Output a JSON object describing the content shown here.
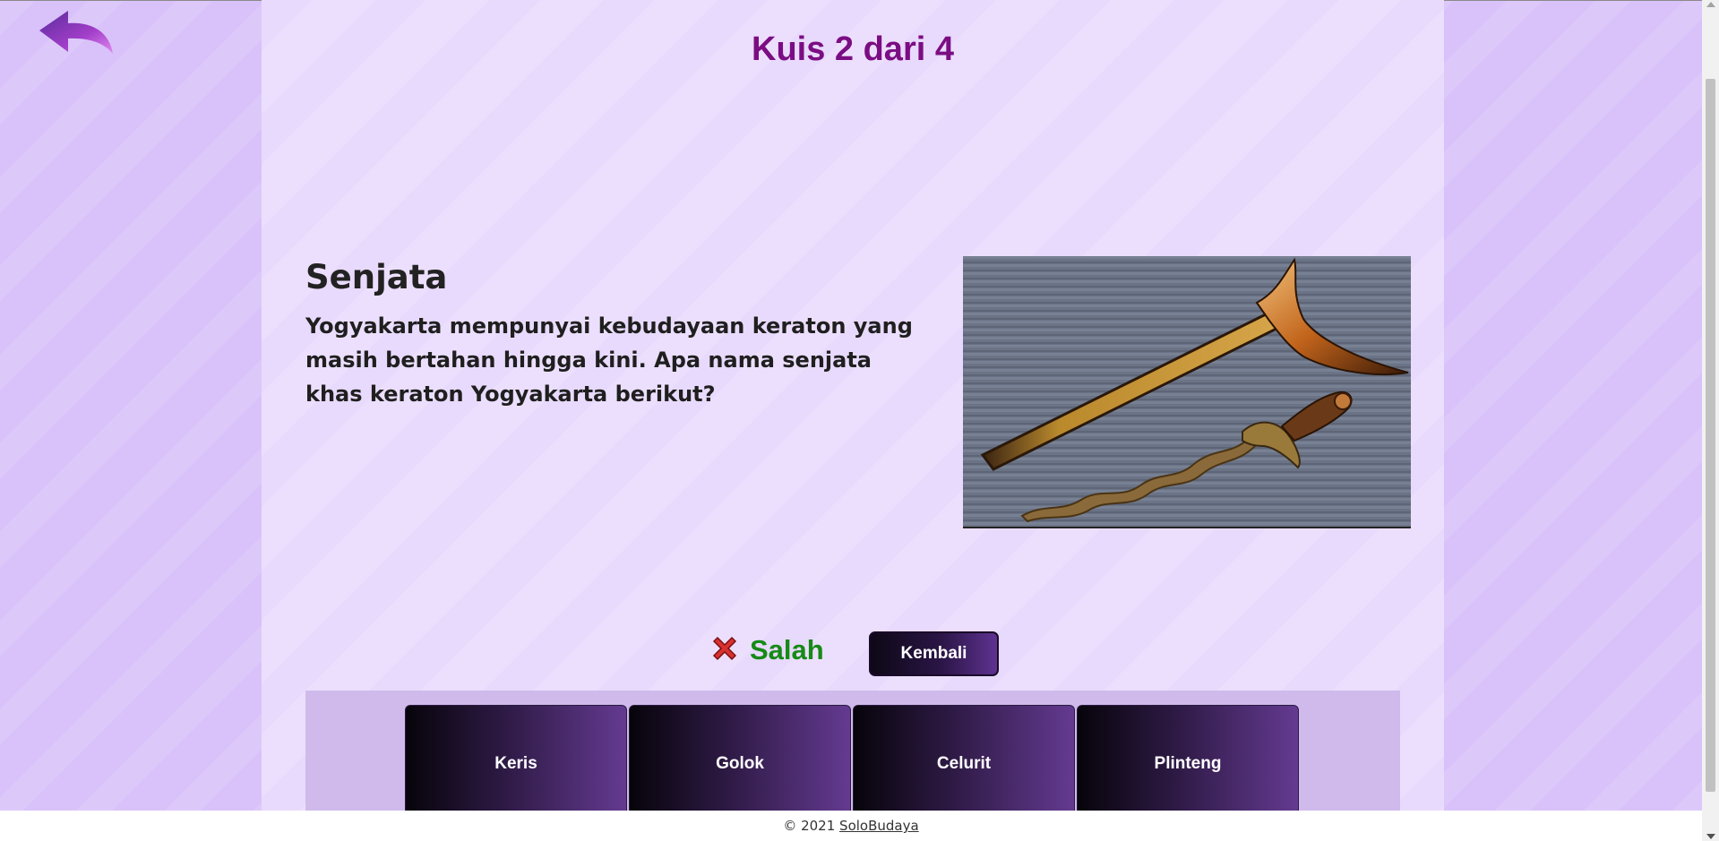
{
  "quiz": {
    "title": "Kuis 2 dari 4",
    "category": "Senjata",
    "question": "Yogyakarta mempunyai kebudayaan keraton yang masih bertahan hingga kini. Apa nama senjata khas keraton Yogyakarta berikut?",
    "image_subject": "keris with wooden sheath"
  },
  "result": {
    "icon": "cross-icon",
    "text": "Salah",
    "text_color": "#168a16",
    "icon_color": "#d93030"
  },
  "kembali_label": "Kembali",
  "answers": [
    {
      "label": "Keris"
    },
    {
      "label": "Golok"
    },
    {
      "label": "Celurit"
    },
    {
      "label": "Plinteng"
    }
  ],
  "footer": {
    "copyright": "© 2021",
    "link_label": "SoloBudaya"
  },
  "colors": {
    "title": "#7b0d83",
    "side_background": "#d9c2fa",
    "panel_background": "#ecdffd",
    "answers_background": "#cfbaeb"
  }
}
